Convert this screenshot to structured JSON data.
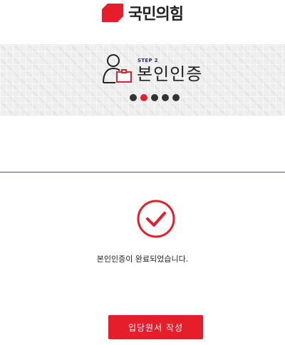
{
  "header": {
    "logo_text": "국민의힘",
    "logo_icon": "party-logo-mark",
    "brand_color": "#e61e2b"
  },
  "step": {
    "label": "STEP 2",
    "title": "본인인증",
    "icon": "user-id-card-icon",
    "current_step": 2,
    "total_steps": 5
  },
  "result": {
    "icon": "check-circle-icon",
    "message": "본인인증이 완료되었습니다."
  },
  "actions": {
    "apply_label": "입당원서 작성"
  },
  "colors": {
    "accent": "#e61e2b",
    "dot_inactive": "#333333",
    "banner_bg": "#eeeeee"
  }
}
